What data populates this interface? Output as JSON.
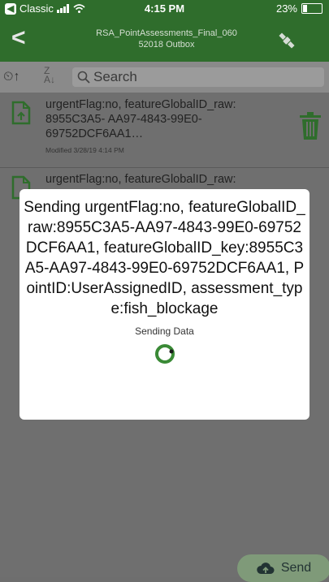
{
  "status_bar": {
    "back_app_label": "Classic",
    "time": "4:15 PM",
    "battery": "23%",
    "battery_level": 0.23
  },
  "nav": {
    "title_line1": "RSA_PointAssessments_Final_060",
    "title_line2": "52018 Outbox"
  },
  "search": {
    "placeholder": "Search"
  },
  "list": {
    "items": [
      {
        "text": "urgentFlag:no, featureGlobalID_raw: 8955C3A5- AA97-4843-99E0-69752DCF6AA1…",
        "meta": "Modified 3/28/19 4:14 PM"
      },
      {
        "text": "urgentFlag:no, featureGlobalID_raw:",
        "meta": ""
      }
    ]
  },
  "modal": {
    "message": "Sending urgentFlag:no, featureGlobalID_raw:8955C3A5-AA97-4843-99E0-69752DCF6AA1, featureGlobalID_key:8955C3A5-AA97-4843-99E0-69752DCF6AA1, PointID:UserAssignedID, assessment_type:fish_blockage",
    "status": "Sending Data"
  },
  "send_button": {
    "label": "Send"
  },
  "colors": {
    "header_green": "#2f6d2c",
    "spinner_green": "#3a8a36",
    "dim_overlay": "#6e6e6e"
  }
}
